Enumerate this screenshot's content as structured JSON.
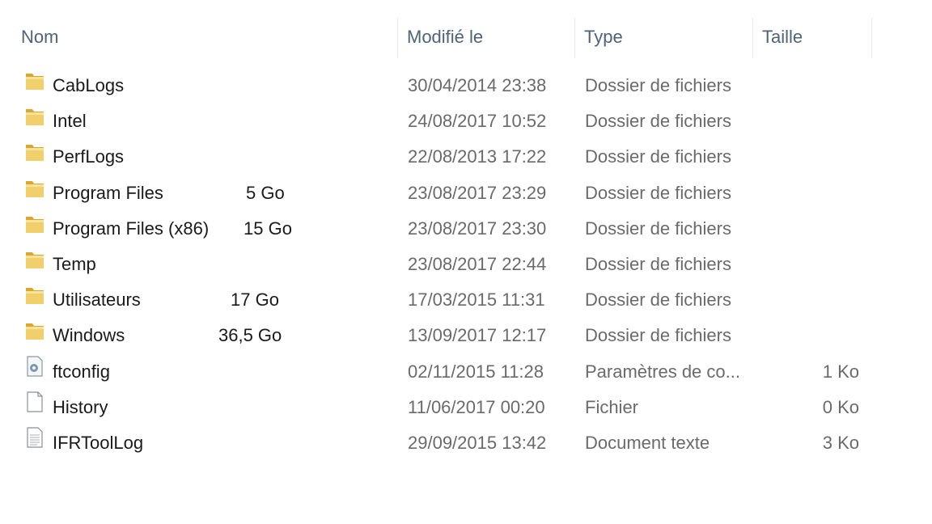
{
  "columns": {
    "name": "Nom",
    "modified": "Modifié le",
    "type": "Type",
    "size": "Taille"
  },
  "rows": [
    {
      "icon": "folder-icon",
      "name": "CabLogs",
      "disk_size": "",
      "modified": "30/04/2014 23:38",
      "type": "Dossier de fichiers",
      "size": ""
    },
    {
      "icon": "folder-icon",
      "name": "Intel",
      "disk_size": "",
      "modified": "24/08/2017 10:52",
      "type": "Dossier de fichiers",
      "size": ""
    },
    {
      "icon": "folder-icon",
      "name": "PerfLogs",
      "disk_size": "",
      "modified": "22/08/2013 17:22",
      "type": "Dossier de fichiers",
      "size": ""
    },
    {
      "icon": "folder-icon",
      "name": "Program Files",
      "disk_size": "5 Go",
      "modified": "23/08/2017 23:29",
      "type": "Dossier de fichiers",
      "size": ""
    },
    {
      "icon": "folder-icon",
      "name": "Program Files (x86)",
      "disk_size": "15 Go",
      "modified": "23/08/2017 23:30",
      "type": "Dossier de fichiers",
      "size": ""
    },
    {
      "icon": "folder-icon",
      "name": "Temp",
      "disk_size": "",
      "modified": "23/08/2017 22:44",
      "type": "Dossier de fichiers",
      "size": ""
    },
    {
      "icon": "folder-icon",
      "name": "Utilisateurs",
      "disk_size": "17 Go",
      "modified": "17/03/2015 11:31",
      "type": "Dossier de fichiers",
      "size": ""
    },
    {
      "icon": "folder-icon",
      "name": "Windows",
      "disk_size": "36,5 Go",
      "modified": "13/09/2017 12:17",
      "type": "Dossier de fichiers",
      "size": ""
    },
    {
      "icon": "config-file-icon",
      "name": "ftconfig",
      "disk_size": "",
      "modified": "02/11/2015 11:28",
      "type": "Paramètres de co...",
      "size": "1 Ko"
    },
    {
      "icon": "blank-file-icon",
      "name": "History",
      "disk_size": "",
      "modified": "11/06/2017 00:20",
      "type": "Fichier",
      "size": "0 Ko"
    },
    {
      "icon": "text-file-icon",
      "name": "IFRToolLog",
      "disk_size": "",
      "modified": "29/09/2015 13:42",
      "type": "Document texte",
      "size": "3 Ko"
    }
  ],
  "colors": {
    "header_text": "#4f6377",
    "name_text": "#1a1a1a",
    "detail_text": "#6a6a6a",
    "folder_yellow": "#e8c25a"
  }
}
